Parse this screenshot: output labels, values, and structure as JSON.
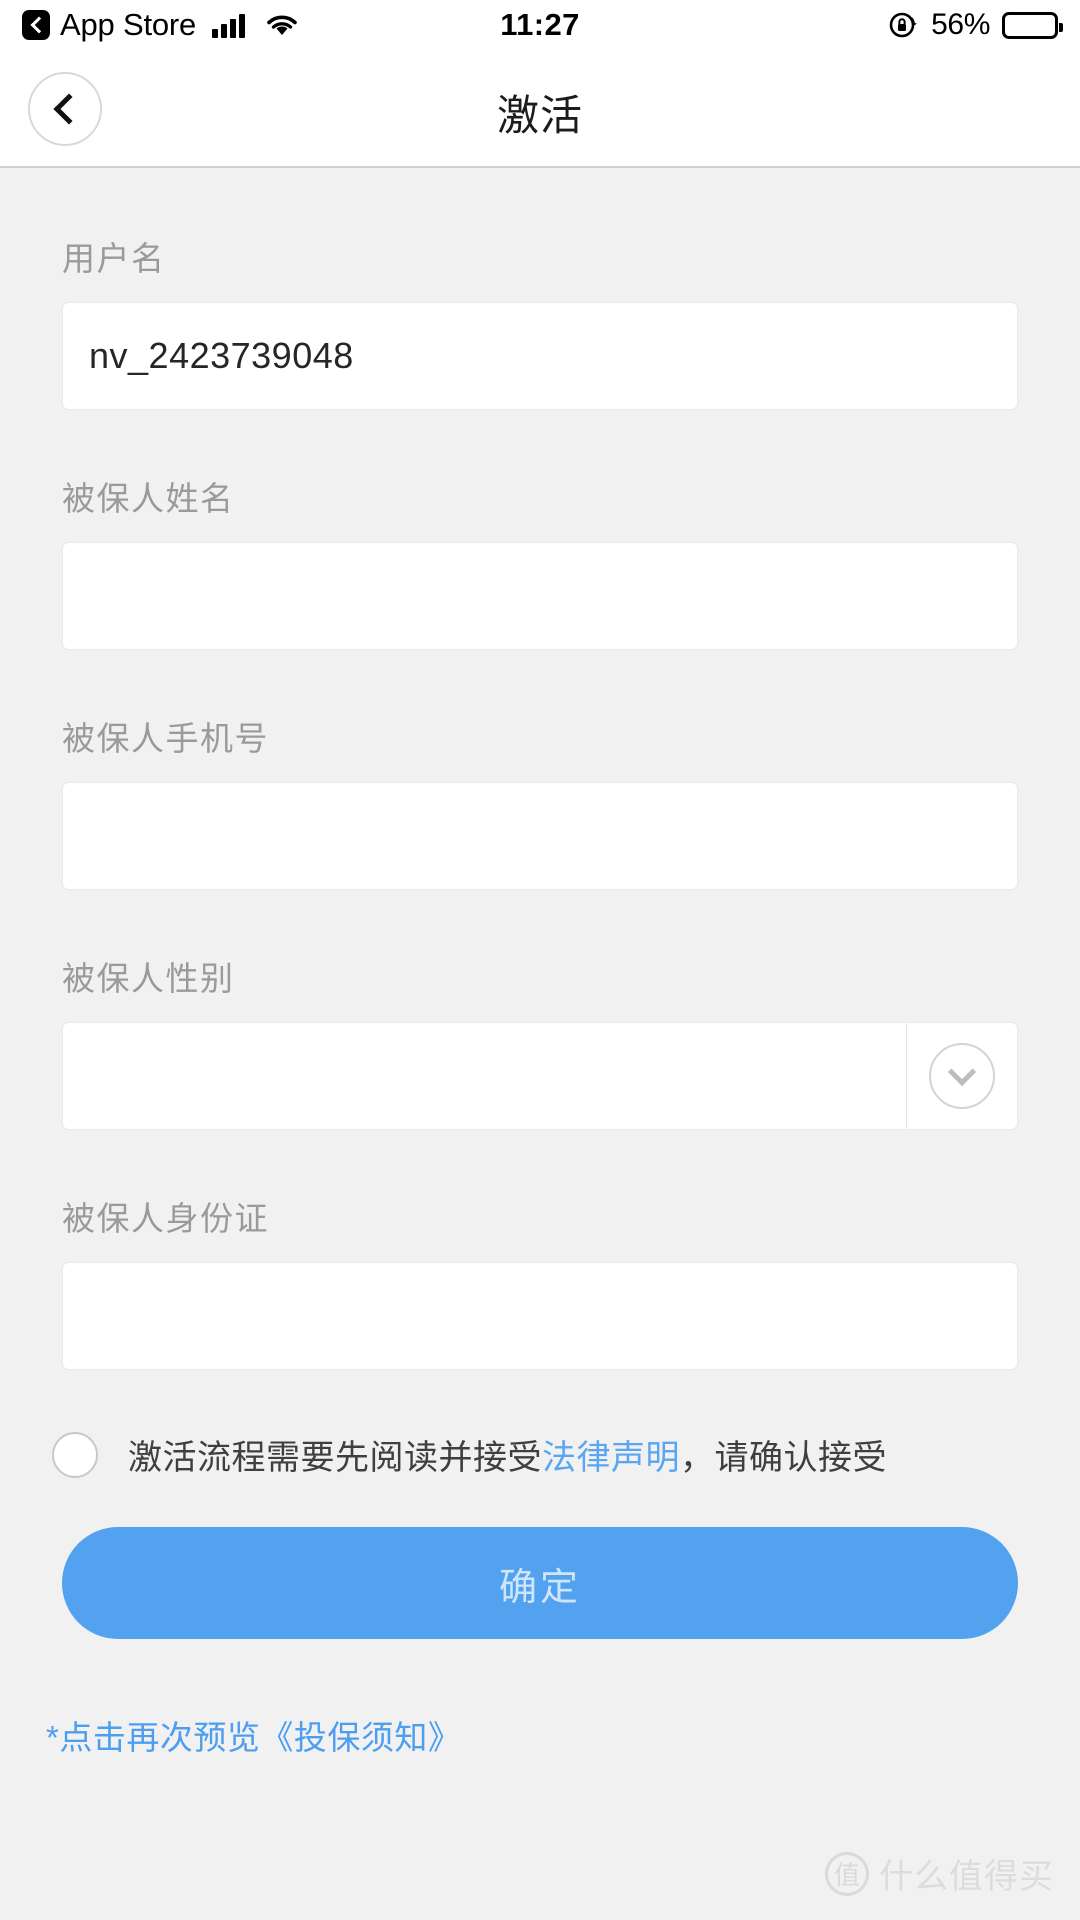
{
  "statusbar": {
    "back_app_label": "App Store",
    "time": "11:27",
    "battery_percent": "56%",
    "battery_level": 56,
    "icons": {
      "back": "back-chevron-icon",
      "signal": "cellular-signal-icon",
      "wifi": "wifi-icon",
      "rotation_lock": "rotation-lock-icon",
      "battery": "battery-icon"
    }
  },
  "navbar": {
    "title": "激活",
    "back_icon": "chevron-left-icon"
  },
  "form": {
    "fields": [
      {
        "label": "用户名",
        "value": "nv_2423739048",
        "type": "text"
      },
      {
        "label": "被保人姓名",
        "value": "",
        "type": "text"
      },
      {
        "label": "被保人手机号",
        "value": "",
        "type": "tel"
      },
      {
        "label": "被保人性别",
        "value": "",
        "type": "select"
      },
      {
        "label": "被保人身份证",
        "value": "",
        "type": "text"
      }
    ]
  },
  "agreement": {
    "checked": false,
    "text_before": "激活流程需要先阅读并接受",
    "link_label": "法律声明",
    "text_after": "，请确认接受"
  },
  "submit": {
    "label": "确定",
    "color": "#52a2ef",
    "enabled": false
  },
  "preview": {
    "label": "*点击再次预览《投保须知》",
    "color": "#4d9ef0"
  },
  "watermark": {
    "badge": "值",
    "text": "什么值得买"
  },
  "theme": {
    "page_bg": "#f1f1f1",
    "card_bg": "#ffffff",
    "label_gray": "#9a9a9a",
    "accent_blue": "#52a2ef"
  }
}
